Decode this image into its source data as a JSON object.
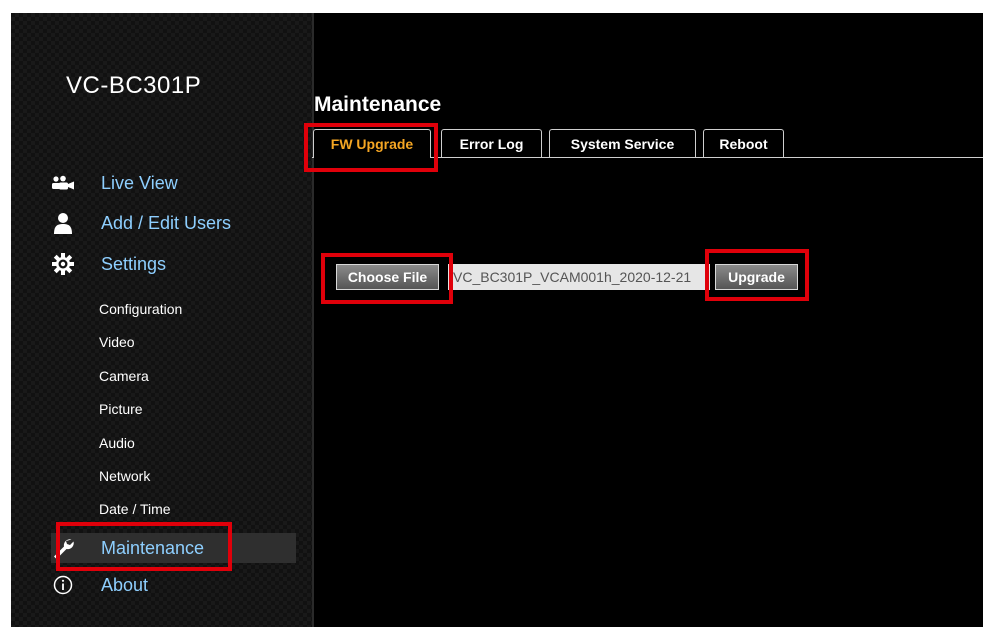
{
  "brand": "VC-BC301P",
  "nav": {
    "live_view": "Live View",
    "add_edit_users": "Add / Edit Users",
    "settings": "Settings",
    "settings_items": [
      "Configuration",
      "Video",
      "Camera",
      "Picture",
      "Audio",
      "Network",
      "Date / Time"
    ],
    "maintenance": "Maintenance",
    "about": "About"
  },
  "main": {
    "title": "Maintenance",
    "tabs": [
      {
        "label": "FW Upgrade",
        "active": true
      },
      {
        "label": "Error Log",
        "active": false
      },
      {
        "label": "System Service",
        "active": false
      },
      {
        "label": "Reboot",
        "active": false
      }
    ],
    "choose_file_label": "Choose File",
    "file_name": "VC_BC301P_VCAM001h_2020-12-21",
    "upgrade_label": "Upgrade"
  },
  "colors": {
    "active_tab_text": "#f5a623",
    "nav_link": "#8ecfff",
    "highlight_box": "#e0000a"
  },
  "icons": {
    "live_view": "group-camera-icon",
    "add_edit_users": "user-icon",
    "settings": "gear-icon",
    "maintenance": "wrench-icon",
    "about": "info-icon"
  }
}
